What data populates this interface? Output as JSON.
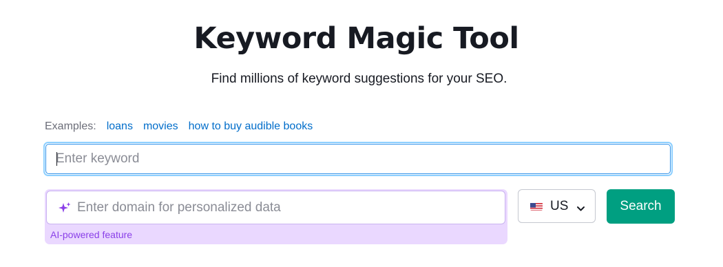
{
  "header": {
    "title": "Keyword Magic Tool",
    "subtitle": "Find millions of keyword suggestions for your SEO."
  },
  "examples": {
    "label": "Examples:",
    "links": [
      "loans",
      "movies",
      "how to buy audible books"
    ]
  },
  "keyword_input": {
    "value": "",
    "placeholder": "Enter keyword"
  },
  "domain_input": {
    "value": "",
    "placeholder": "Enter domain for personalized data",
    "icon": "sparkle-icon",
    "ai_label": "AI-powered feature"
  },
  "country_select": {
    "selected": "US",
    "flag": "us-flag-icon"
  },
  "search_button": {
    "label": "Search"
  },
  "colors": {
    "accent_link": "#006dca",
    "search_button": "#009f81",
    "ai_background": "#ead8ff",
    "ai_text": "#8a3fe8",
    "focus_border": "#8ccfff"
  }
}
